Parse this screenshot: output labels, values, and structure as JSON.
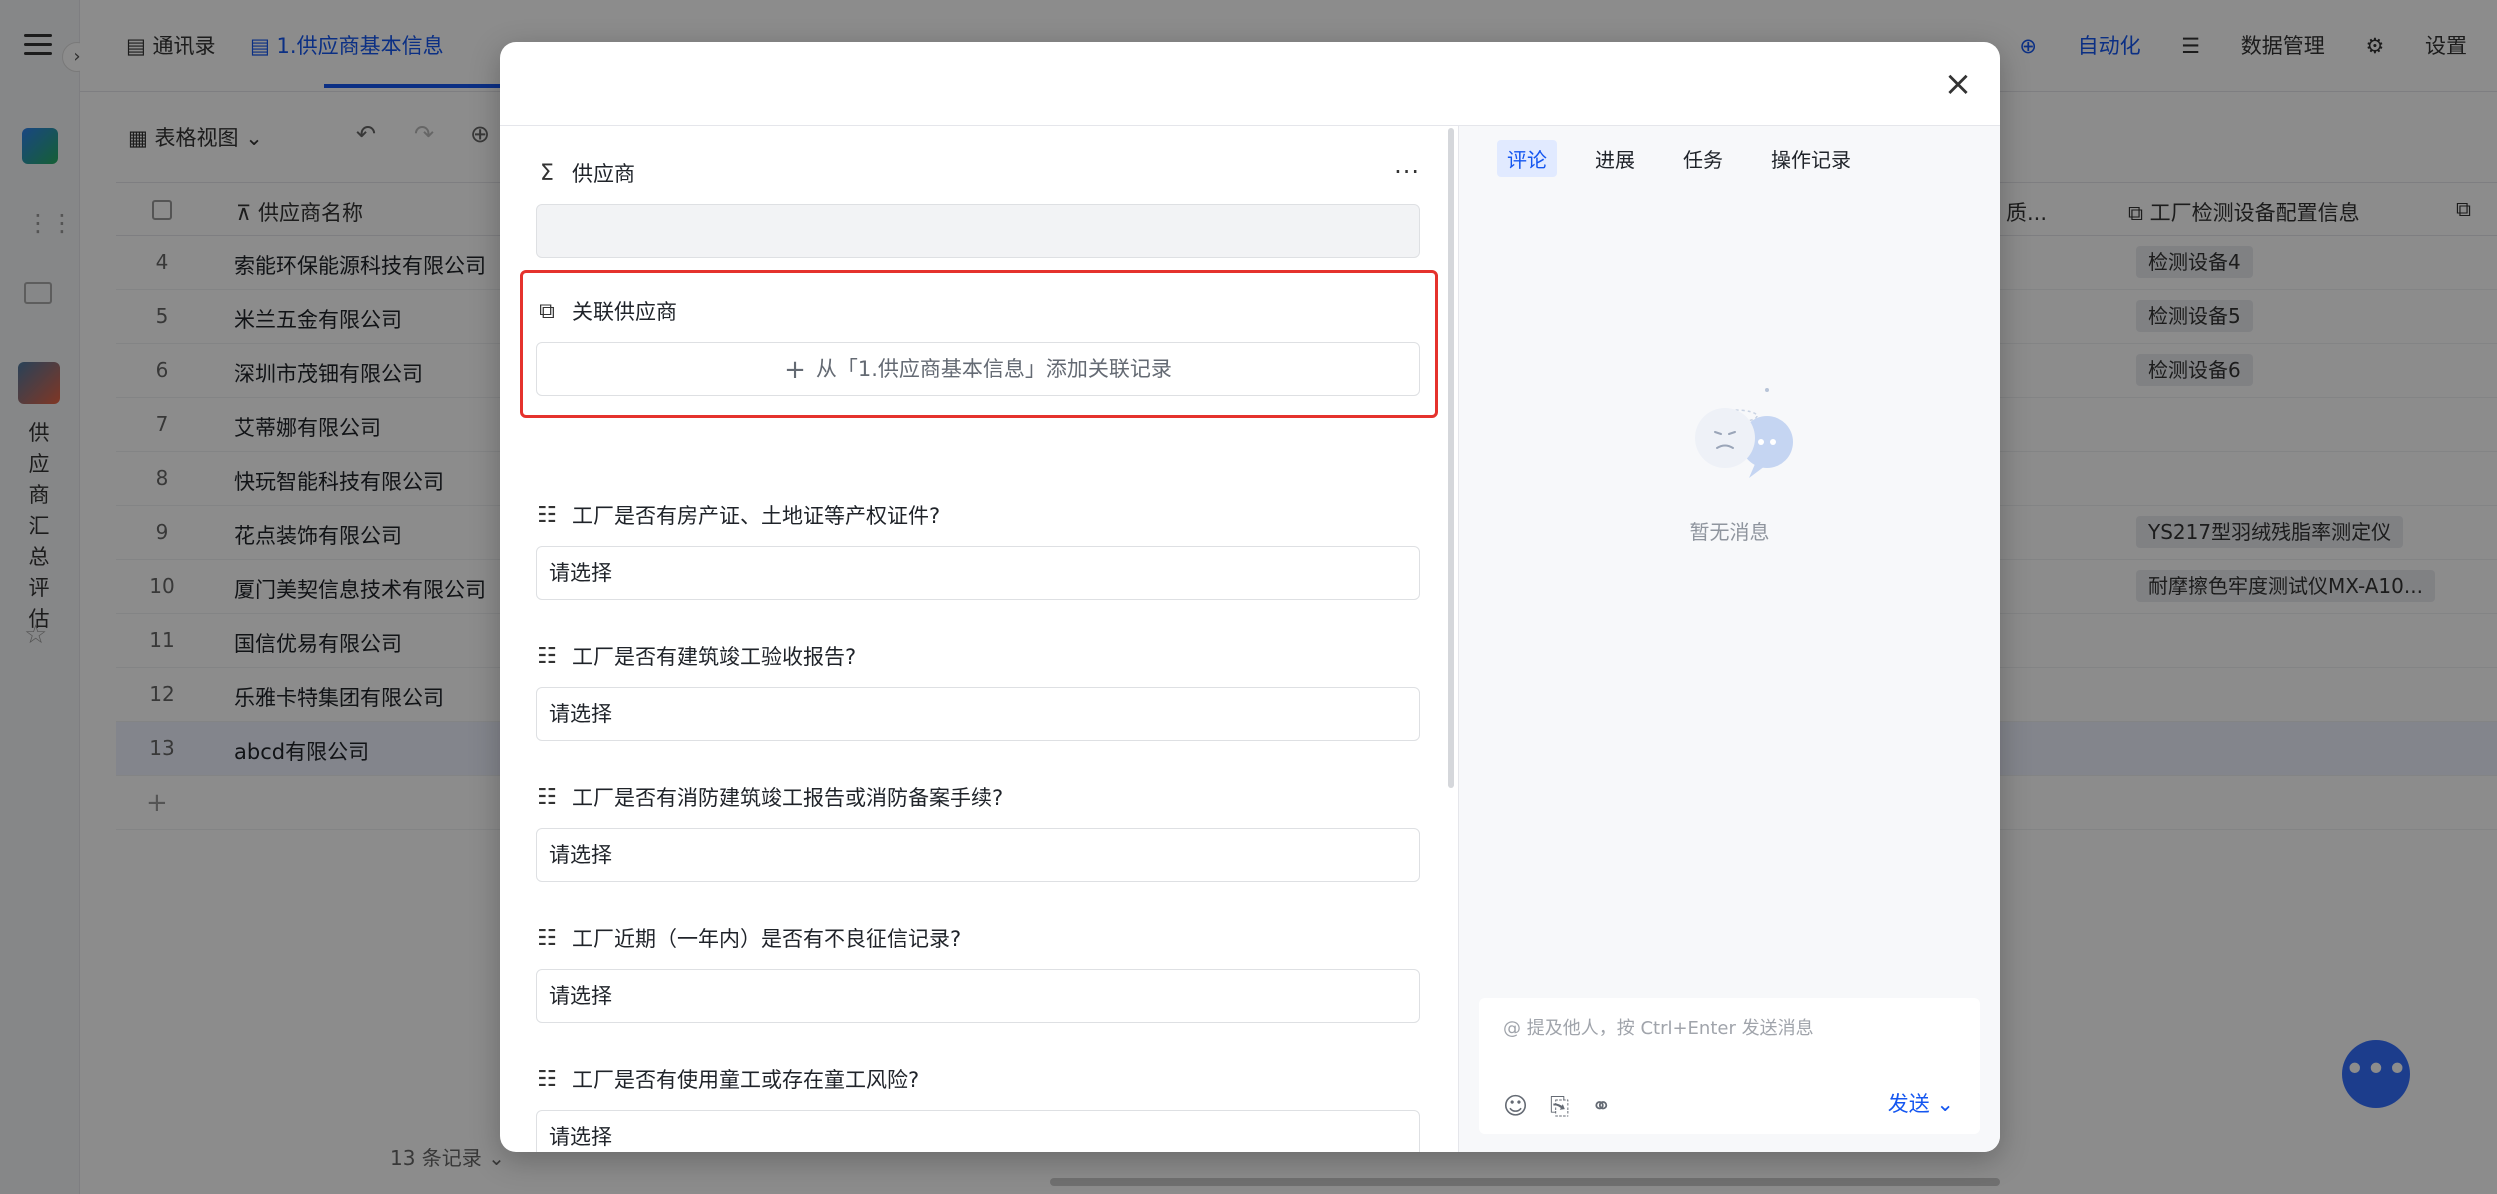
{
  "background": {
    "rail": {
      "vertical_text": "供应商汇总评估"
    },
    "tabs": [
      {
        "label": "通讯录"
      },
      {
        "label": "1.供应商基本信息"
      }
    ],
    "tabbar_right": {
      "automation": "自动化",
      "data_mgmt": "数据管理",
      "settings": "设置"
    },
    "toolbar": {
      "view_label": "表格视图"
    },
    "grid": {
      "col_name": "供应商名称",
      "col_quality_partial": "质...",
      "col_equipment": "工厂检测设备配置信息",
      "rows": [
        {
          "num": "4",
          "name": "索能环保能源科技有限公司",
          "tag": "检测设备4"
        },
        {
          "num": "5",
          "name": "米兰五金有限公司",
          "tag": "检测设备5"
        },
        {
          "num": "6",
          "name": "深圳市茂钿有限公司",
          "tag": "检测设备6"
        },
        {
          "num": "7",
          "name": "艾蒂娜有限公司",
          "tag": ""
        },
        {
          "num": "8",
          "name": "快玩智能科技有限公司",
          "tag": ""
        },
        {
          "num": "9",
          "name": "花点装饰有限公司",
          "tag": "YS217型羽绒残脂率测定仪"
        },
        {
          "num": "10",
          "name": "厦门美契信息技术有限公司",
          "tag": "耐摩擦色牢度测试仪MX-A10..."
        },
        {
          "num": "11",
          "name": "国信优易有限公司",
          "tag": ""
        },
        {
          "num": "12",
          "name": "乐雅卡特集团有限公司",
          "tag": ""
        },
        {
          "num": "13",
          "name": "abcd有限公司",
          "tag": ""
        }
      ],
      "footer_count": "13 条记录"
    }
  },
  "modal": {
    "fields": [
      {
        "icon": "Σ",
        "label": "供应商",
        "type": "formula"
      },
      {
        "icon": "⧉",
        "label": "关联供应商",
        "type": "link",
        "add_text": "从「1.供应商基本信息」添加关联记录"
      },
      {
        "icon": "☷",
        "label": "工厂是否有房产证、土地证等产权证件?",
        "type": "select",
        "value": "请选择"
      },
      {
        "icon": "☷",
        "label": "工厂是否有建筑竣工验收报告?",
        "type": "select",
        "value": "请选择"
      },
      {
        "icon": "☷",
        "label": "工厂是否有消防建筑竣工报告或消防备案手续?",
        "type": "select",
        "value": "请选择"
      },
      {
        "icon": "☷",
        "label": "工厂近期（一年内）是否有不良征信记录?",
        "type": "select",
        "value": "请选择"
      },
      {
        "icon": "☷",
        "label": "工厂是否有使用童工或存在童工风险?",
        "type": "select",
        "value": "请选择"
      }
    ],
    "side": {
      "tabs": [
        "评论",
        "进展",
        "任务",
        "操作记录"
      ],
      "empty_text": "暂无消息",
      "composer_placeholder": "@ 提及他人，按 Ctrl+Enter 发送消息",
      "send_label": "发送"
    }
  }
}
